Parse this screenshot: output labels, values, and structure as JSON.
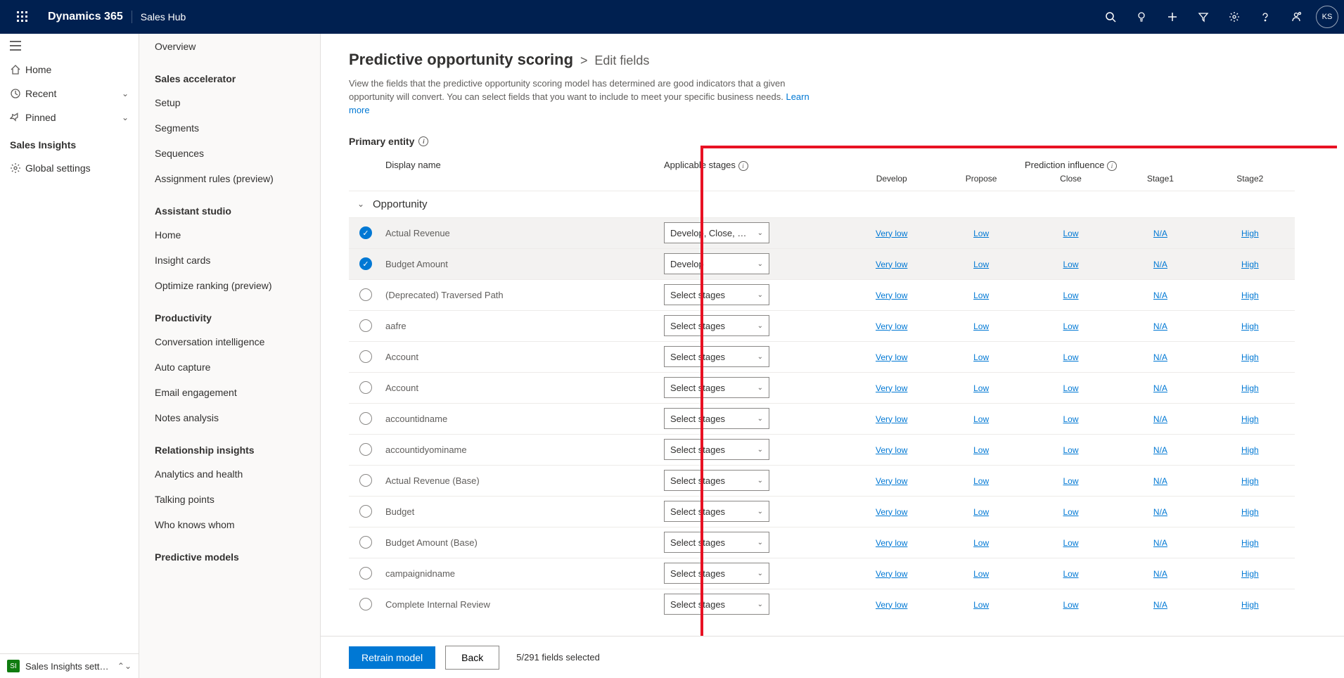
{
  "topbar": {
    "brand": "Dynamics 365",
    "app": "Sales Hub",
    "avatar": "KS"
  },
  "leftnav": {
    "items": [
      {
        "icon": "home",
        "label": "Home"
      },
      {
        "icon": "clock",
        "label": "Recent",
        "chev": true
      },
      {
        "icon": "pin",
        "label": "Pinned",
        "chev": true
      }
    ],
    "section": "Sales Insights",
    "section_items": [
      {
        "icon": "gear",
        "label": "Global settings",
        "selected": true
      }
    ],
    "bottom": {
      "badge": "SI",
      "label": "Sales Insights sett…",
      "chev": "⌃⌄"
    }
  },
  "sidebar2": {
    "groups": [
      {
        "items": [
          "Overview"
        ]
      },
      {
        "heading": "Sales accelerator",
        "items": [
          "Setup",
          "Segments",
          "Sequences",
          "Assignment rules (preview)"
        ]
      },
      {
        "heading": "Assistant studio",
        "items": [
          "Home",
          "Insight cards",
          "Optimize ranking (preview)"
        ]
      },
      {
        "heading": "Productivity",
        "items": [
          "Conversation intelligence",
          "Auto capture",
          "Email engagement",
          "Notes analysis"
        ]
      },
      {
        "heading": "Relationship insights",
        "items": [
          "Analytics and health",
          "Talking points",
          "Who knows whom"
        ]
      },
      {
        "heading": "Predictive models",
        "items": []
      }
    ]
  },
  "main": {
    "title": "Predictive opportunity scoring",
    "crumb": "Edit fields",
    "desc": "View the fields that the predictive opportunity scoring model has determined are good indicators that a given opportunity will convert. You can select fields that you want to include to meet your specific business needs. ",
    "learn_more": "Learn more",
    "primary_entity": "Primary entity",
    "cols": {
      "display": "Display name",
      "stages": "Applicable stages",
      "influence": "Prediction influence"
    },
    "stages": [
      "Develop",
      "Propose",
      "Close",
      "Stage1",
      "Stage2"
    ],
    "group": "Opportunity",
    "default_stage": "Select stages",
    "rows": [
      {
        "sel": true,
        "name": "Actual Revenue",
        "stage": "Develop, Close, …",
        "inf": [
          "Very low",
          "Low",
          "Low",
          "N/A",
          "High"
        ]
      },
      {
        "sel": true,
        "name": "Budget Amount",
        "stage": "Develop",
        "inf": [
          "Very low",
          "Low",
          "Low",
          "N/A",
          "High"
        ]
      },
      {
        "sel": false,
        "name": "(Deprecated) Traversed Path",
        "stage": "Select stages",
        "inf": [
          "Very low",
          "Low",
          "Low",
          "N/A",
          "High"
        ]
      },
      {
        "sel": false,
        "name": "aafre",
        "stage": "Select stages",
        "inf": [
          "Very low",
          "Low",
          "Low",
          "N/A",
          "High"
        ]
      },
      {
        "sel": false,
        "name": "Account",
        "stage": "Select stages",
        "inf": [
          "Very low",
          "Low",
          "Low",
          "N/A",
          "High"
        ]
      },
      {
        "sel": false,
        "name": "Account",
        "stage": "Select stages",
        "inf": [
          "Very low",
          "Low",
          "Low",
          "N/A",
          "High"
        ]
      },
      {
        "sel": false,
        "name": "accountidname",
        "stage": "Select stages",
        "inf": [
          "Very low",
          "Low",
          "Low",
          "N/A",
          "High"
        ]
      },
      {
        "sel": false,
        "name": "accountidyominame",
        "stage": "Select stages",
        "inf": [
          "Very low",
          "Low",
          "Low",
          "N/A",
          "High"
        ]
      },
      {
        "sel": false,
        "name": "Actual Revenue (Base)",
        "stage": "Select stages",
        "inf": [
          "Very low",
          "Low",
          "Low",
          "N/A",
          "High"
        ]
      },
      {
        "sel": false,
        "name": "Budget",
        "stage": "Select stages",
        "inf": [
          "Very low",
          "Low",
          "Low",
          "N/A",
          "High"
        ]
      },
      {
        "sel": false,
        "name": "Budget Amount (Base)",
        "stage": "Select stages",
        "inf": [
          "Very low",
          "Low",
          "Low",
          "N/A",
          "High"
        ]
      },
      {
        "sel": false,
        "name": "campaignidname",
        "stage": "Select stages",
        "inf": [
          "Very low",
          "Low",
          "Low",
          "N/A",
          "High"
        ]
      },
      {
        "sel": false,
        "name": "Complete Internal Review",
        "stage": "Select stages",
        "inf": [
          "Very low",
          "Low",
          "Low",
          "N/A",
          "High"
        ]
      }
    ],
    "footer": {
      "retrain": "Retrain model",
      "back": "Back",
      "count": "5/291 fields selected"
    }
  }
}
